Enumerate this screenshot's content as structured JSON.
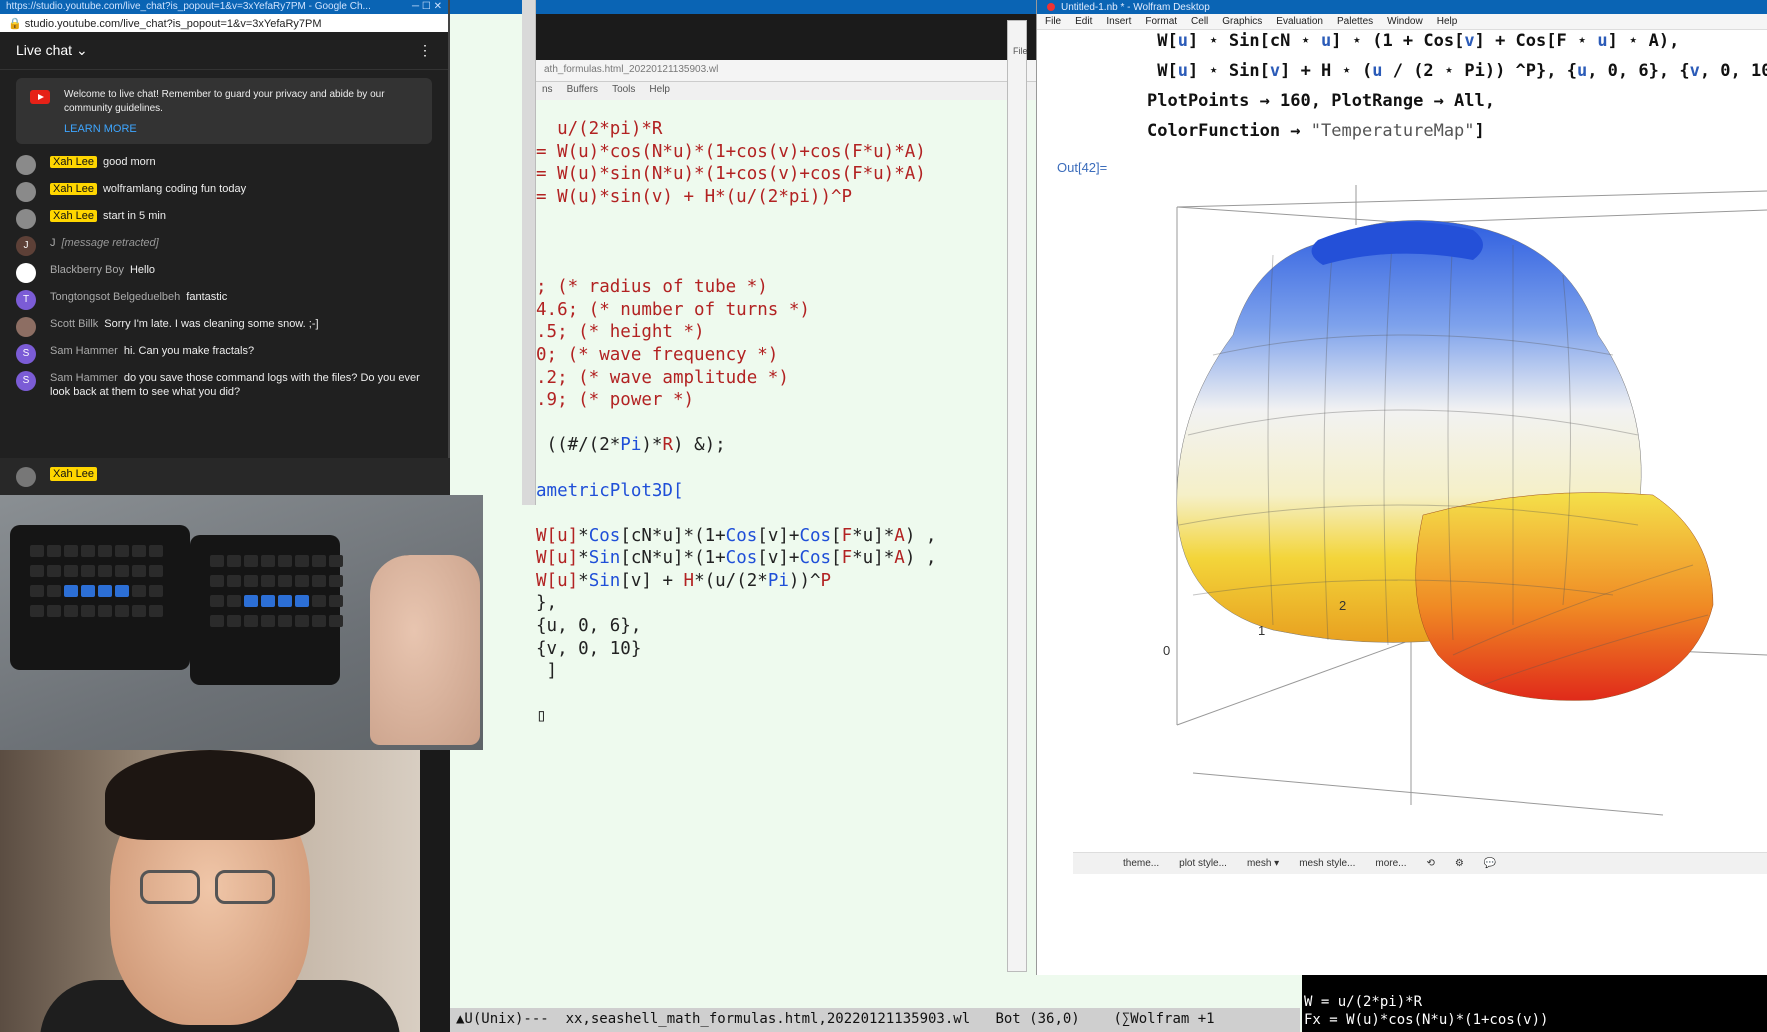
{
  "chat": {
    "window_title": "https://studio.youtube.com/live_chat?is_popout=1&v=3xYefaRy7PM - Google Ch...",
    "url": "studio.youtube.com/live_chat?is_popout=1&v=3xYefaRy7PM",
    "header": "Live chat",
    "welcome_text": "Welcome to live chat! Remember to guard your privacy and abide by our community guidelines.",
    "learn_more": "LEARN MORE",
    "messages": [
      {
        "author": "Xah Lee",
        "text": "good morn",
        "owner": true,
        "initial": ""
      },
      {
        "author": "Xah Lee",
        "text": "wolframlang coding fun today",
        "owner": true,
        "initial": ""
      },
      {
        "author": "Xah Lee",
        "text": "start in 5 min",
        "owner": true,
        "initial": ""
      },
      {
        "author": "J",
        "text": "[message retracted]",
        "owner": false,
        "initial": "J"
      },
      {
        "author": "Blackberry Boy",
        "text": "Hello",
        "owner": false,
        "initial": ""
      },
      {
        "author": "Tongtongsot Belgeduelbeh",
        "text": "fantastic",
        "owner": false,
        "initial": "T"
      },
      {
        "author": "Scott Billk",
        "text": "Sorry I'm late. I was cleaning some snow. ;-]",
        "owner": false,
        "initial": ""
      },
      {
        "author": "Sam Hammer",
        "text": "hi. Can you make fractals?",
        "owner": false,
        "initial": "S"
      },
      {
        "author": "Sam Hammer",
        "text": "do you save those command logs with the files? Do you ever look back at them to see what you did?",
        "owner": false,
        "initial": "S"
      }
    ],
    "composer_author": "Xah Lee"
  },
  "emacs": {
    "tab_title": "ath_formulas.html_20220121135903.wl",
    "menu": [
      "ns",
      "Buffers",
      "Tools",
      "Help"
    ],
    "modeline": "▲U(Unix)---  xx,seashell_math_formulas.html,20220121135903.wl   Bot (36,0)    (∑Wolfram +1"
  },
  "wolfram": {
    "title": "Untitled-1.nb * - Wolfram Desktop",
    "menu": [
      "File",
      "Edit",
      "Insert",
      "Format",
      "Cell",
      "Graphics",
      "Evaluation",
      "Palettes",
      "Window",
      "Help"
    ],
    "side_file": "File",
    "out_label": "Out[42]=",
    "toolbar": [
      "theme...",
      "plot style...",
      "mesh ▾",
      "mesh style...",
      "more..."
    ],
    "axis_labels": [
      "0",
      "1",
      "2"
    ]
  },
  "popup": {
    "line1": "W = u/(2*pi)*R",
    "line2": "Fx = W(u)*cos(N*u)*(1+cos(v))"
  }
}
